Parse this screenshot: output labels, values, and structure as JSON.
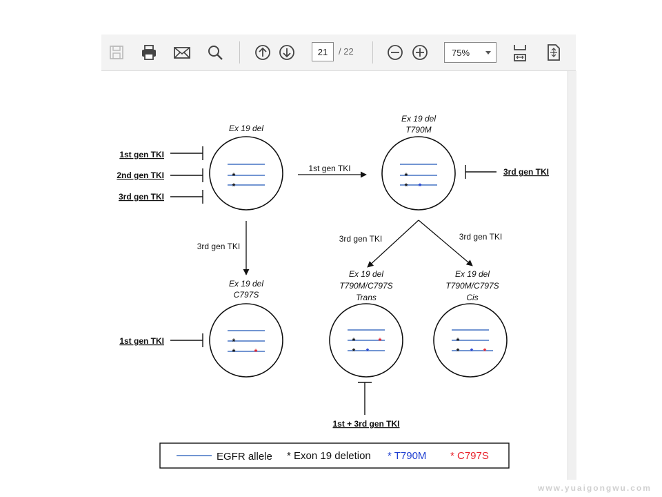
{
  "toolbar": {
    "page_current": "21",
    "page_total": "/ 22",
    "zoom": "75%"
  },
  "figure": {
    "top_left": {
      "line1": "Ex 19 del"
    },
    "top_right": {
      "line1": "Ex 19 del",
      "line2": "T790M"
    },
    "bottom_left": {
      "line1": "Ex 19 del",
      "line2": "C797S"
    },
    "bottom_mid": {
      "line1": "Ex 19 del",
      "line2": "T790M/C797S",
      "line3": "Trans"
    },
    "bottom_right": {
      "line1": "Ex 19 del",
      "line2": "T790M/C797S",
      "line3": "Cis"
    },
    "inhibitors_top_left": [
      "1st gen TKI",
      "2nd gen TKI",
      "3rd gen TKI"
    ],
    "inhibitor_top_right": "3rd gen TKI",
    "inhibitor_bottom_left": "1st gen TKI",
    "inhibitor_bottom_mid": "1st + 3rd  gen TKI",
    "arrow_top": "1st gen TKI",
    "arrow_left_down": "3rd gen TKI",
    "arrow_to_trans": "3rd gen TKI",
    "arrow_to_cis": "3rd gen TKI",
    "star": "*"
  },
  "legend": {
    "allele": "EGFR allele",
    "exon19": "* Exon 19 deletion",
    "t790m": "* T790M",
    "c797s": "* C797S"
  },
  "colors": {
    "allele_line": "#4472c4",
    "t790m": "#1f3fd1",
    "c797s": "#e8202a",
    "exon19": "#111111"
  },
  "watermark": "www.yuaigongwu.com"
}
